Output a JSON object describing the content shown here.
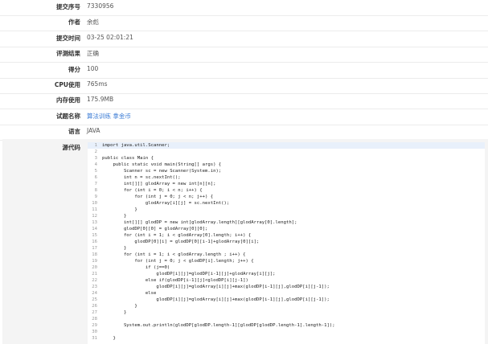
{
  "submission": {
    "fields": [
      {
        "label": "提交序号",
        "value": "7330956",
        "link": false
      },
      {
        "label": "作者",
        "value": "余彪",
        "link": false
      },
      {
        "label": "提交时间",
        "value": "03-25 02:01:21",
        "link": false
      },
      {
        "label": "评测结果",
        "value": "正确",
        "link": false
      },
      {
        "label": "得分",
        "value": "100",
        "link": false
      },
      {
        "label": "CPU使用",
        "value": "765ms",
        "link": false
      },
      {
        "label": "内存使用",
        "value": "175.9MB",
        "link": false
      },
      {
        "label": "试题名称",
        "value": "算法训练 拿金币",
        "link": true
      },
      {
        "label": "语言",
        "value": "JAVA",
        "link": false
      }
    ]
  },
  "code": {
    "label": "源代码",
    "lines": [
      "import java.util.Scanner;",
      "",
      "public class Main {",
      "    public static void main(String[] args) {",
      "        Scanner sc = new Scanner(System.in);",
      "        int n = sc.nextInt();",
      "        int[][] glodArray = new int[n][n];",
      "        for (int i = 0; i < n; i++) {",
      "            for (int j = 0; j < n; j++) {",
      "                glodArray[i][j] = sc.nextInt();",
      "            }",
      "        }",
      "        int[][] glodDP = new int[glodArray.length][glodArray[0].length];",
      "        glodDP[0][0] = glodArray[0][0];",
      "        for (int i = 1; i < glodArray[0].length; i++) {",
      "            glodDP[0][i] = glodDP[0][i-1]+glodArray[0][i];",
      "        }",
      "        for (int i = 1; i < glodArray.length ; i++) {",
      "            for (int j = 0; j < glodDP[i].length; j++) {",
      "                if (j==0)",
      "                    glodDP[i][j]=glodDP[i-1][j]+glodArray[i][j];",
      "                else if(glodDP[i-1][j]<glodDP[i][j-1])",
      "                    glodDP[i][j]=glodArray[i][j]+max(glodDP[i-1][j],glodDP[i][j-1]);",
      "                else",
      "                    glodDP[i][j]=glodArray[i][j]+max(glodDP[i-1][j],glodDP[i][j-1]);",
      "            }",
      "        }",
      "",
      "        System.out.println(glodDP[glodDP.length-1][glodDP[glodDP.length-1].length-1]);",
      "",
      "    }"
    ]
  }
}
